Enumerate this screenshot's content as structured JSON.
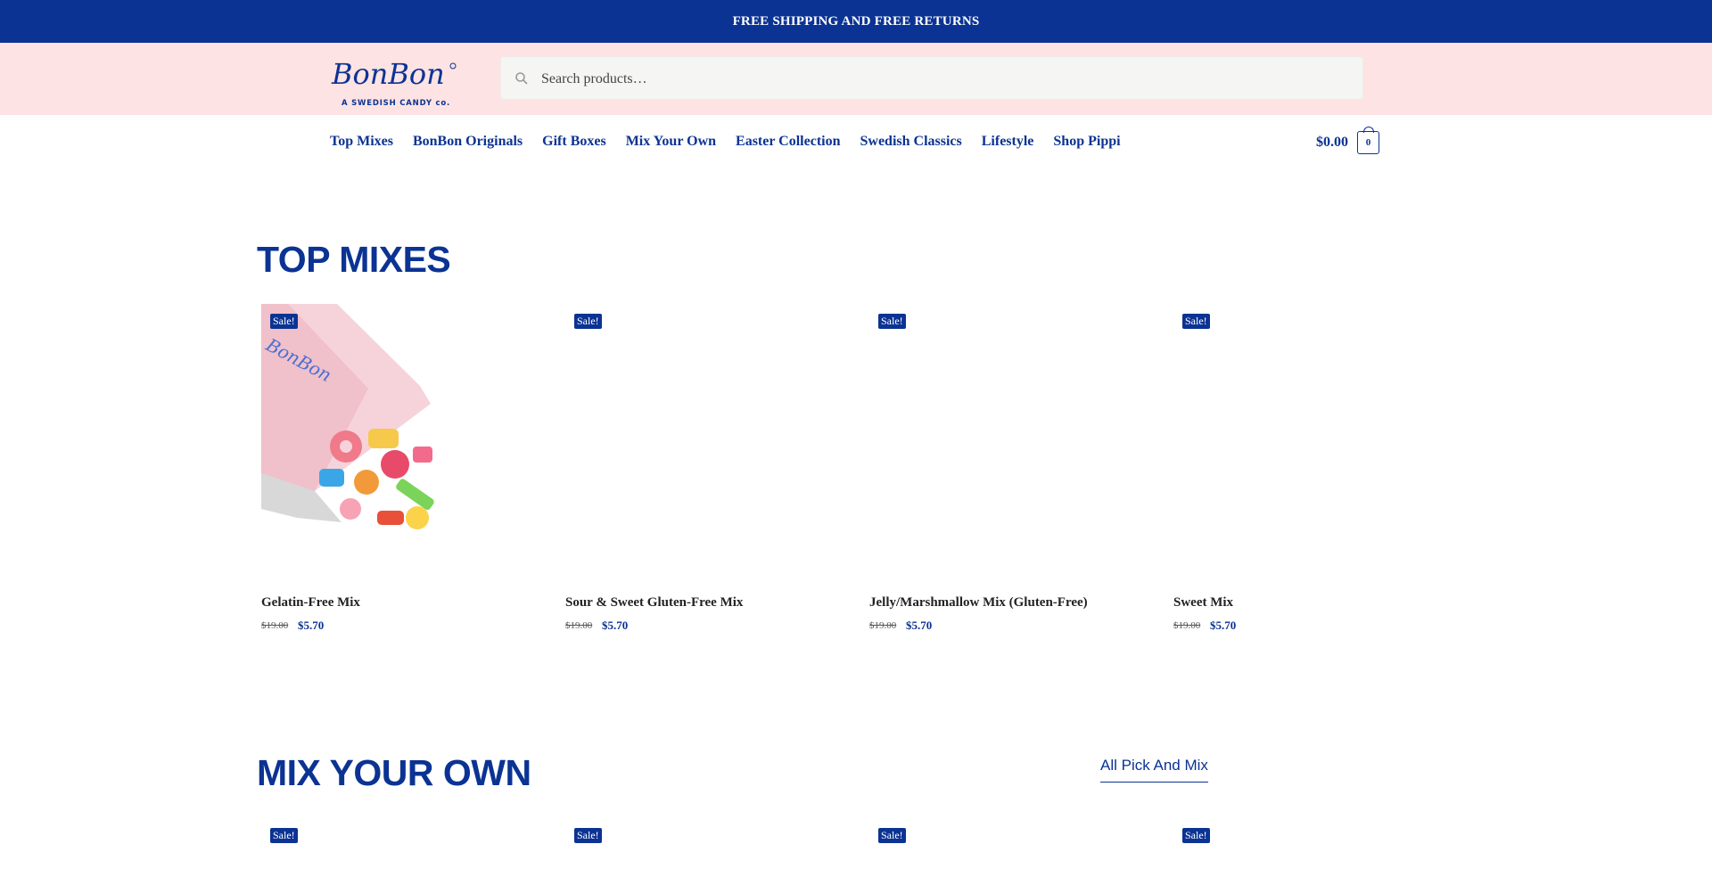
{
  "announcement": "FREE SHIPPING AND FREE RETURNS",
  "brand": {
    "name": "BonBon",
    "tagline": "A SWEDISH CANDY co."
  },
  "search": {
    "placeholder": "Search products…"
  },
  "nav": [
    "Top Mixes",
    "BonBon Originals",
    "Gift Boxes",
    "Mix Your Own",
    "Easter Collection",
    "Swedish Classics",
    "Lifestyle",
    "Shop Pippi"
  ],
  "cart": {
    "total": "$0.00",
    "count": "0"
  },
  "sections": {
    "top_mixes": {
      "title": "TOP MIXES",
      "products": [
        {
          "badge": "Sale!",
          "name": "Gelatin-Free Mix",
          "old_price": "$19.00",
          "price": "$5.70"
        },
        {
          "badge": "Sale!",
          "name": "Sour & Sweet Gluten-Free Mix",
          "old_price": "$19.00",
          "price": "$5.70"
        },
        {
          "badge": "Sale!",
          "name": "Jelly/Marshmallow Mix (Gluten-Free)",
          "old_price": "$19.00",
          "price": "$5.70"
        },
        {
          "badge": "Sale!",
          "name": "Sweet Mix",
          "old_price": "$19.00",
          "price": "$5.70"
        }
      ]
    },
    "mix_your_own": {
      "title": "MIX YOUR OWN",
      "link": "All Pick And Mix",
      "badges": [
        "Sale!",
        "Sale!",
        "Sale!",
        "Sale!"
      ]
    }
  },
  "colors": {
    "brand_blue": "#0b3393",
    "header_pink": "#fde3e3"
  }
}
